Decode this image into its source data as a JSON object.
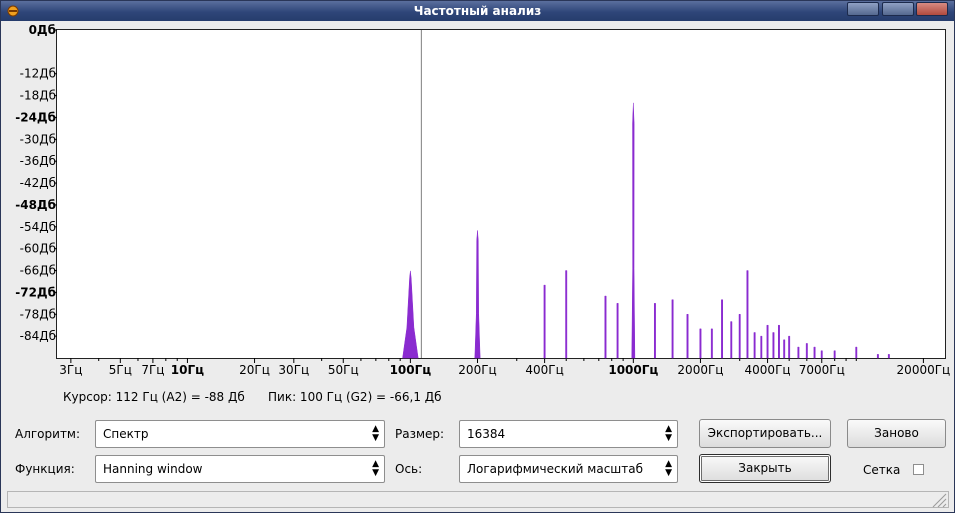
{
  "window": {
    "title": "Частотный анализ",
    "accent": "#2f4679",
    "close_color": "#b04a3e"
  },
  "chart_data": {
    "type": "area",
    "title": "",
    "xlabel": "",
    "ylabel": "",
    "x_scale": "log",
    "xlim": [
      2.6,
      25000
    ],
    "ylim": [
      -90,
      0
    ],
    "grid": false,
    "series_color": "#8a2bd0",
    "cursor_x": 112,
    "y_ticks": [
      {
        "value": 0,
        "label": "0Дб",
        "major": true
      },
      {
        "value": -12,
        "label": "-12Дб",
        "major": false
      },
      {
        "value": -18,
        "label": "-18Дб",
        "major": false
      },
      {
        "value": -24,
        "label": "-24Дб",
        "major": true
      },
      {
        "value": -30,
        "label": "-30Дб",
        "major": false
      },
      {
        "value": -36,
        "label": "-36Дб",
        "major": false
      },
      {
        "value": -42,
        "label": "-42Дб",
        "major": false
      },
      {
        "value": -48,
        "label": "-48Дб",
        "major": true
      },
      {
        "value": -54,
        "label": "-54Дб",
        "major": false
      },
      {
        "value": -60,
        "label": "-60Дб",
        "major": false
      },
      {
        "value": -66,
        "label": "-66Дб",
        "major": false
      },
      {
        "value": -72,
        "label": "-72Дб",
        "major": true
      },
      {
        "value": -78,
        "label": "-78Дб",
        "major": false
      },
      {
        "value": -84,
        "label": "-84Дб",
        "major": false
      }
    ],
    "x_ticks": [
      {
        "value": 3,
        "label": "3Гц",
        "major": false
      },
      {
        "value": 5,
        "label": "5Гц",
        "major": false
      },
      {
        "value": 7,
        "label": "7Гц",
        "major": false
      },
      {
        "value": 10,
        "label": "10Гц",
        "major": true
      },
      {
        "value": 20,
        "label": "20Гц",
        "major": false
      },
      {
        "value": 30,
        "label": "30Гц",
        "major": false
      },
      {
        "value": 50,
        "label": "50Гц",
        "major": false
      },
      {
        "value": 100,
        "label": "100Гц",
        "major": true
      },
      {
        "value": 200,
        "label": "200Гц",
        "major": false
      },
      {
        "value": 400,
        "label": "400Гц",
        "major": false
      },
      {
        "value": 1000,
        "label": "1000Гц",
        "major": true
      },
      {
        "value": 2000,
        "label": "2000Гц",
        "major": false
      },
      {
        "value": 4000,
        "label": "4000Гц",
        "major": false
      },
      {
        "value": 7000,
        "label": "7000Гц",
        "major": false
      },
      {
        "value": 20000,
        "label": "20000Гц",
        "major": false
      }
    ],
    "peaks": [
      {
        "freq": 100,
        "db": -66.1,
        "width": 0.035
      },
      {
        "freq": 200,
        "db": -55,
        "width": 0.012
      },
      {
        "freq": 400,
        "db": -70,
        "width": 0.005
      },
      {
        "freq": 500,
        "db": -66,
        "width": 0.004
      },
      {
        "freq": 750,
        "db": -73,
        "width": 0.003
      },
      {
        "freq": 850,
        "db": -75,
        "width": 0.003
      },
      {
        "freq": 1000,
        "db": -20,
        "width": 0.007
      },
      {
        "freq": 1250,
        "db": -75,
        "width": 0.002
      },
      {
        "freq": 1500,
        "db": -74,
        "width": 0.002
      },
      {
        "freq": 1750,
        "db": -78,
        "width": 0.002
      },
      {
        "freq": 2000,
        "db": -82,
        "width": 0.002
      },
      {
        "freq": 2250,
        "db": -82,
        "width": 0.002
      },
      {
        "freq": 2500,
        "db": -74,
        "width": 0.002
      },
      {
        "freq": 2750,
        "db": -80,
        "width": 0.002
      },
      {
        "freq": 3000,
        "db": -78,
        "width": 0.002
      },
      {
        "freq": 3250,
        "db": -66,
        "width": 0.002
      },
      {
        "freq": 3500,
        "db": -83,
        "width": 0.002
      },
      {
        "freq": 3750,
        "db": -84,
        "width": 0.002
      },
      {
        "freq": 4000,
        "db": -81,
        "width": 0.002
      },
      {
        "freq": 4250,
        "db": -83,
        "width": 0.002
      },
      {
        "freq": 4500,
        "db": -81,
        "width": 0.002
      },
      {
        "freq": 4750,
        "db": -85,
        "width": 0.002
      },
      {
        "freq": 5000,
        "db": -84,
        "width": 0.002
      },
      {
        "freq": 5500,
        "db": -87,
        "width": 0.002
      },
      {
        "freq": 6000,
        "db": -86,
        "width": 0.002
      },
      {
        "freq": 6500,
        "db": -87,
        "width": 0.002
      },
      {
        "freq": 7000,
        "db": -88,
        "width": 0.002
      },
      {
        "freq": 8000,
        "db": -88,
        "width": 0.002
      },
      {
        "freq": 10000,
        "db": -87,
        "width": 0.002
      },
      {
        "freq": 12500,
        "db": -89,
        "width": 0.002
      },
      {
        "freq": 14000,
        "db": -89,
        "width": 0.002
      }
    ]
  },
  "info": {
    "cursor_text": "Курсор: 112 Гц (A2) = -88 Дб",
    "peak_text": "Пик: 100 Гц (G2) = -66,1 Дб"
  },
  "controls": {
    "algorithm_label": "Алгоритм:",
    "algorithm_value": "Спектр",
    "function_label": "Функция:",
    "function_value": "Hanning window",
    "size_label": "Размер:",
    "size_value": "16384",
    "axis_label": "Ось:",
    "axis_value": "Логарифмический масштаб",
    "export_label": "Экспортировать...",
    "redo_label": "Заново",
    "close_label": "Закрыть",
    "grid_label": "Сетка",
    "grid_checked": false
  }
}
